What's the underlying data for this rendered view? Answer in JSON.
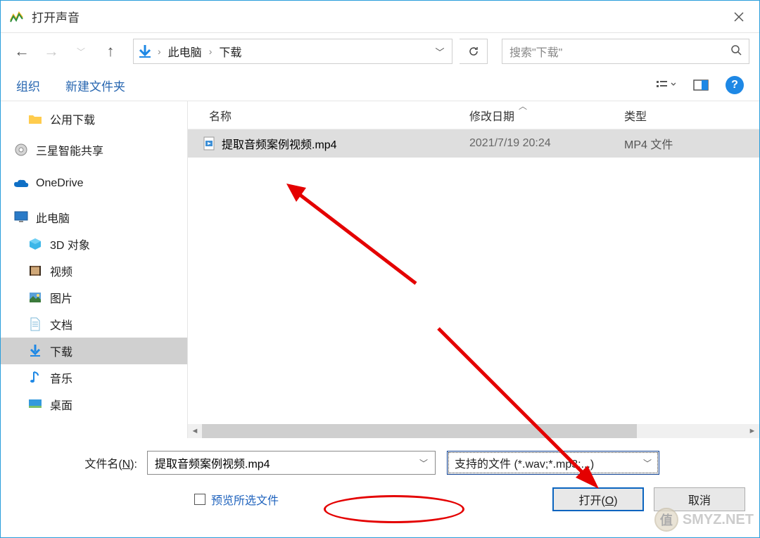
{
  "title": "打开声音",
  "breadcrumbs": {
    "root": "此电脑",
    "folder": "下载"
  },
  "search": {
    "placeholder": "搜索\"下载\""
  },
  "toolbar": {
    "organize": "组织",
    "new_folder": "新建文件夹"
  },
  "columns": {
    "name": "名称",
    "modified": "修改日期",
    "type": "类型"
  },
  "sidebar": {
    "items": [
      {
        "label": "公用下载",
        "icon": "folder-yellow",
        "indent": "child"
      },
      {
        "label": "三星智能共享",
        "icon": "disk",
        "indent": "root"
      },
      {
        "label": "OneDrive",
        "icon": "onedrive",
        "indent": "root"
      },
      {
        "label": "此电脑",
        "icon": "monitor",
        "indent": "root"
      },
      {
        "label": "3D 对象",
        "icon": "cube",
        "indent": "child"
      },
      {
        "label": "视频",
        "icon": "video",
        "indent": "child"
      },
      {
        "label": "图片",
        "icon": "image",
        "indent": "child"
      },
      {
        "label": "文档",
        "icon": "document",
        "indent": "child"
      },
      {
        "label": "下载",
        "icon": "download-arrow",
        "indent": "child",
        "selected": true
      },
      {
        "label": "音乐",
        "icon": "music",
        "indent": "child"
      },
      {
        "label": "桌面",
        "icon": "desktop",
        "indent": "child"
      }
    ]
  },
  "files": [
    {
      "name": "提取音频案例视频.mp4",
      "modified": "2021/7/19 20:24",
      "type": "MP4 文件"
    }
  ],
  "bottom": {
    "filename_label": "文件名(N):",
    "filename_value": "提取音频案例视频.mp4",
    "filetype_value": "支持的文件 (*.wav;*.mp3;...)",
    "preview_label": "预览所选文件",
    "open_button": "打开(O)",
    "cancel_button": "取消"
  },
  "watermark": {
    "text": "SMYZ.NET",
    "coin": "值"
  }
}
